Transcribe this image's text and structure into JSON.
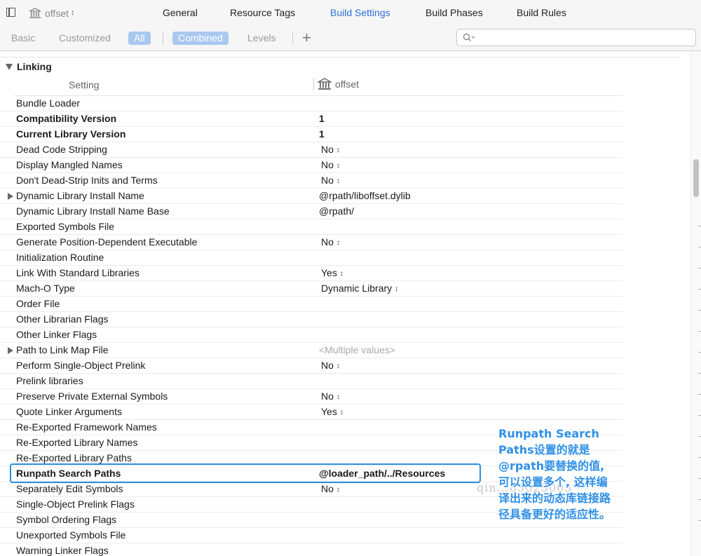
{
  "target_selector": {
    "name": "offset"
  },
  "tabs": [
    {
      "label": "General"
    },
    {
      "label": "Resource Tags"
    },
    {
      "label": "Build Settings"
    },
    {
      "label": "Build Phases"
    },
    {
      "label": "Build Rules"
    }
  ],
  "filters": {
    "basic": "Basic",
    "customized": "Customized",
    "all": "All",
    "combined": "Combined",
    "levels": "Levels"
  },
  "search": {
    "placeholder": ""
  },
  "section": {
    "title": "Linking"
  },
  "columns": {
    "setting": "Setting",
    "target": "offset"
  },
  "rows": [
    {
      "name": "Bundle Loader",
      "value": ""
    },
    {
      "name": "Compatibility Version",
      "value": "1"
    },
    {
      "name": "Current Library Version",
      "value": "1"
    },
    {
      "name": "Dead Code Stripping",
      "value": "No"
    },
    {
      "name": "Display Mangled Names",
      "value": "No"
    },
    {
      "name": "Don't Dead-Strip Inits and Terms",
      "value": "No"
    },
    {
      "name": "Dynamic Library Install Name",
      "value": "@rpath/liboffset.dylib"
    },
    {
      "name": "Dynamic Library Install Name Base",
      "value": "@rpath/"
    },
    {
      "name": "Exported Symbols File",
      "value": ""
    },
    {
      "name": "Generate Position-Dependent Executable",
      "value": "No"
    },
    {
      "name": "Initialization Routine",
      "value": ""
    },
    {
      "name": "Link With Standard Libraries",
      "value": "Yes"
    },
    {
      "name": "Mach-O Type",
      "value": "Dynamic Library"
    },
    {
      "name": "Order File",
      "value": ""
    },
    {
      "name": "Other Librarian Flags",
      "value": ""
    },
    {
      "name": "Other Linker Flags",
      "value": ""
    },
    {
      "name": "Path to Link Map File",
      "value": "<Multiple values>"
    },
    {
      "name": "Perform Single-Object Prelink",
      "value": "No"
    },
    {
      "name": "Prelink libraries",
      "value": ""
    },
    {
      "name": "Preserve Private External Symbols",
      "value": "No"
    },
    {
      "name": "Quote Linker Arguments",
      "value": "Yes"
    },
    {
      "name": "Re-Exported Framework Names",
      "value": ""
    },
    {
      "name": "Re-Exported Library Names",
      "value": ""
    },
    {
      "name": "Re-Exported Library Paths",
      "value": ""
    },
    {
      "name": "Runpath Search Paths",
      "value": "@loader_path/../Resources"
    },
    {
      "name": "Separately Edit Symbols",
      "value": "No"
    },
    {
      "name": "Single-Object Prelink Flags",
      "value": ""
    },
    {
      "name": "Symbol Ordering Flags",
      "value": ""
    },
    {
      "name": "Unexported Symbols File",
      "value": ""
    },
    {
      "name": "Warning Linker Flags",
      "value": ""
    }
  ],
  "annotation": {
    "lines": [
      "Runpath Search",
      "Paths设置的就是",
      "@rpath要替换的值,",
      "可以设置多个, 这样编",
      "译出来的动态库链接路",
      "径具备更好的适应性。"
    ]
  },
  "watermark": "qin...85025005",
  "colors": {
    "accent": "#2f6fd6",
    "filter_selected": "#a8c8ef",
    "annotation": "#2f8fe6"
  }
}
